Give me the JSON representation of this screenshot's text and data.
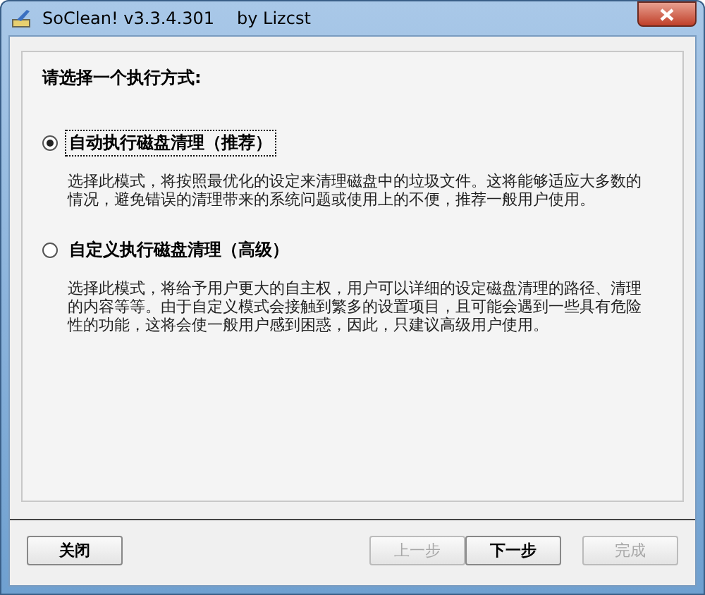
{
  "window": {
    "title": "SoClean! v3.3.4.301",
    "author": "by Lizcst"
  },
  "prompt": "请选择一个执行方式:",
  "options": [
    {
      "label": "自动执行磁盘清理（推荐）",
      "selected": true,
      "description": "选择此模式，将按照最优化的设定来清理磁盘中的垃圾文件。这将能够适应大多数的情况，避免错误的清理带来的系统问题或使用上的不便，推荐一般用户使用。"
    },
    {
      "label": "自定义执行磁盘清理（高级）",
      "selected": false,
      "description": "选择此模式，将给予用户更大的自主权，用户可以详细的设定磁盘清理的路径、清理的内容等等。由于自定义模式会接触到繁多的设置项目，且可能会遇到一些具有危险性的功能，这将会使一般用户感到困惑，因此，只建议高级用户使用。"
    }
  ],
  "buttons": [
    {
      "label": "关闭",
      "disabled": false
    },
    {
      "label": "上一步",
      "disabled": true
    },
    {
      "label": "下一步",
      "disabled": false
    },
    {
      "label": "完成",
      "disabled": true
    }
  ]
}
